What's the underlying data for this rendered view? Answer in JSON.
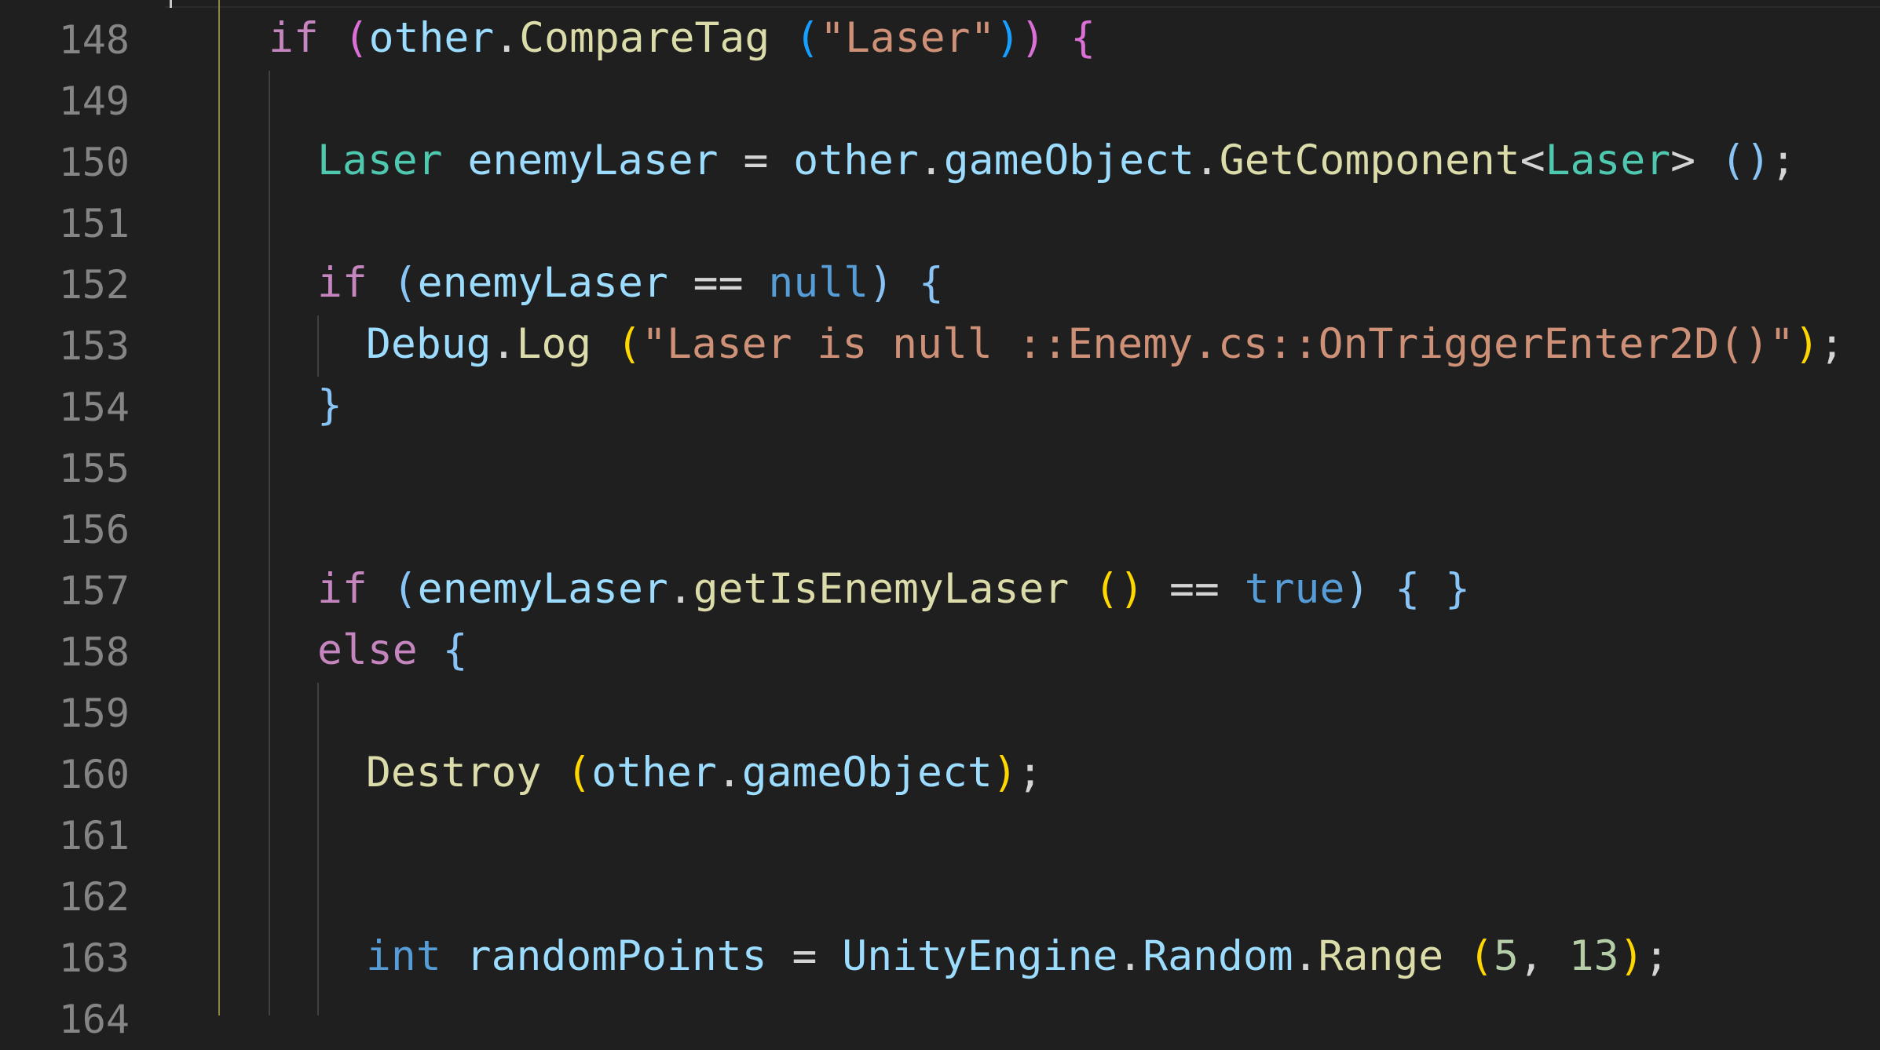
{
  "line_numbers": [
    "148",
    "149",
    "150",
    "151",
    "152",
    "153",
    "154",
    "155",
    "156",
    "157",
    "158",
    "159",
    "160",
    "161",
    "162",
    "163",
    "164"
  ],
  "tokens": {
    "l148": [
      "if",
      " ",
      "(",
      "other",
      ".",
      "CompareTag",
      " ",
      "(",
      "\"Laser\"",
      ")",
      ")",
      " ",
      "{"
    ],
    "l150": [
      "Laser",
      " ",
      "enemyLaser",
      " = ",
      "other",
      ".",
      "gameObject",
      ".",
      "GetComponent",
      "<",
      "Laser",
      ">",
      " ",
      "(",
      ")",
      ";"
    ],
    "l152": [
      "if",
      " ",
      "(",
      "enemyLaser",
      " == ",
      "null",
      ")",
      " ",
      "{"
    ],
    "l153": [
      "Debug",
      ".",
      "Log",
      " ",
      "(",
      "\"Laser is null ::Enemy.cs::OnTriggerEnter2D()\"",
      ")",
      ";"
    ],
    "l154": [
      "}"
    ],
    "l157": [
      "if",
      " ",
      "(",
      "enemyLaser",
      ".",
      "getIsEnemyLaser",
      " ",
      "(",
      ")",
      " == ",
      "true",
      ")",
      " ",
      "{",
      " ",
      "}"
    ],
    "l158": [
      "else",
      " ",
      "{"
    ],
    "l160": [
      "Destroy",
      " ",
      "(",
      "other",
      ".",
      "gameObject",
      ")",
      ";"
    ],
    "l163": [
      "int",
      " ",
      "randomPoints",
      " = ",
      "UnityEngine",
      ".",
      "Random",
      ".",
      "Range",
      " ",
      "(",
      "5",
      ", ",
      "13",
      ")",
      ";"
    ]
  }
}
